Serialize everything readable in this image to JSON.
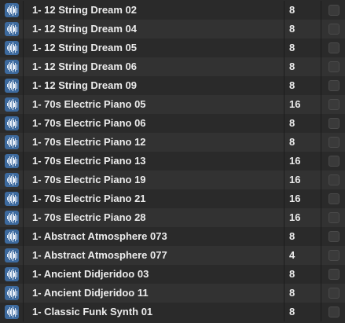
{
  "rows": [
    {
      "name": "1- 12 String Dream 02",
      "beats": "8",
      "favorite": false
    },
    {
      "name": "1- 12 String Dream 04",
      "beats": "8",
      "favorite": false
    },
    {
      "name": "1- 12 String Dream 05",
      "beats": "8",
      "favorite": false
    },
    {
      "name": "1- 12 String Dream 06",
      "beats": "8",
      "favorite": false
    },
    {
      "name": "1- 12 String Dream 09",
      "beats": "8",
      "favorite": false
    },
    {
      "name": "1- 70s Electric Piano 05",
      "beats": "16",
      "favorite": false
    },
    {
      "name": "1- 70s Electric Piano 06",
      "beats": "8",
      "favorite": false
    },
    {
      "name": "1- 70s Electric Piano 12",
      "beats": "8",
      "favorite": false
    },
    {
      "name": "1- 70s Electric Piano 13",
      "beats": "16",
      "favorite": false
    },
    {
      "name": "1- 70s Electric Piano 19",
      "beats": "16",
      "favorite": false
    },
    {
      "name": "1- 70s Electric Piano 21",
      "beats": "16",
      "favorite": false
    },
    {
      "name": "1- 70s Electric Piano 28",
      "beats": "16",
      "favorite": false
    },
    {
      "name": "1- Abstract Atmosphere 073",
      "beats": "8",
      "favorite": false
    },
    {
      "name": "1- Abstract Atmosphere 077",
      "beats": "4",
      "favorite": false
    },
    {
      "name": "1- Ancient Didjeridoo 03",
      "beats": "8",
      "favorite": false
    },
    {
      "name": "1- Ancient Didjeridoo 11",
      "beats": "8",
      "favorite": false
    },
    {
      "name": "1- Classic Funk Synth 01",
      "beats": "8",
      "favorite": false
    }
  ],
  "icon": "audio-waveform-icon",
  "colors": {
    "background": "#2a2a2a",
    "row_alt": "#323232",
    "icon_bg": "#3d6a9e",
    "text": "#ececec"
  }
}
